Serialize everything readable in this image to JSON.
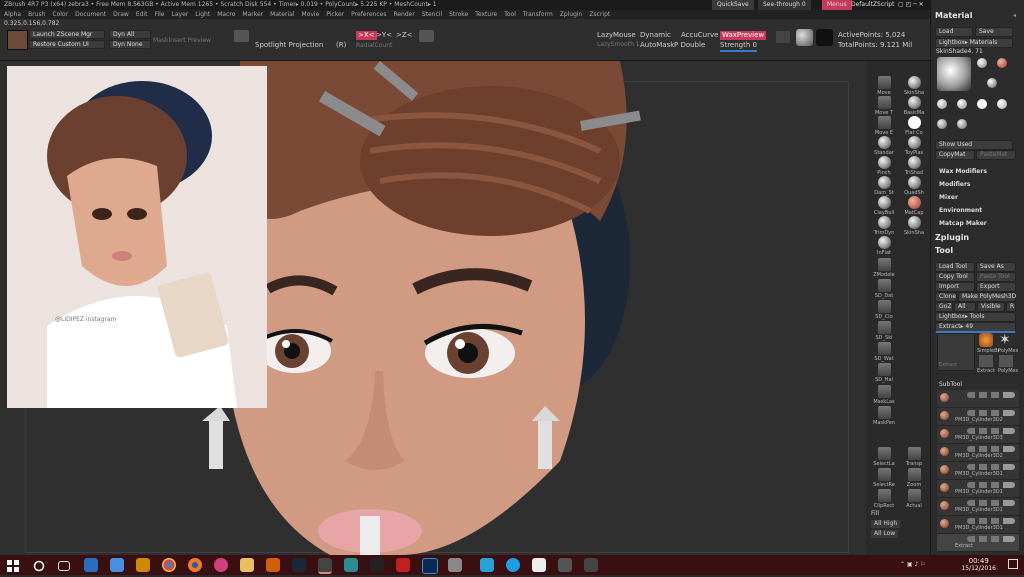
{
  "titlebar": {
    "title": "ZBrush 4R7 P3 (x64)   zebra3   • Free Mem 8.563GB • Active Mem 1265 • Scratch Disk 554 • Timer▸ 0.019 • PolyCount▸ 5.225 KP • MeshCount▸ 1",
    "quicksave": "QuickSave",
    "seethrough": "See-through  0",
    "menus": "Menus",
    "defaultzscript": "DefaultZScript"
  },
  "menubar": [
    "Alpha",
    "Brush",
    "Color",
    "Document",
    "Draw",
    "Edit",
    "File",
    "Layer",
    "Light",
    "Macro",
    "Marker",
    "Material",
    "Movie",
    "Picker",
    "Preferences",
    "Render",
    "Stencil",
    "Stroke",
    "Texture",
    "Tool",
    "Transform",
    "Zplugin",
    "Zscript"
  ],
  "shelf": {
    "coords": "0.325,0.156,0.782",
    "launch": "Launch ZScene Mgr",
    "restore": "Restore Custom UI",
    "dyn_all": "Dyn All",
    "dyn_none": "Dyn None",
    "mask_insert": "MaskInsert Preview",
    "spotlight": "Spotlight Projection",
    "r_label": "(R)",
    "sym_x": ">X<",
    "sym_y": ">Y<",
    "sym_z": ">Z<",
    "radial": "RadialCount",
    "lazymouse": "LazyMouse",
    "lazysmooth": "LazySmooth 1",
    "dynamic": "Dynamic",
    "accucurve": "AccuCurve",
    "automask": "AutoMask",
    "p_double": "P Double",
    "waxpreview": "WaxPreview",
    "strength": "Strength 0",
    "activepoints": "ActivePoints: 5,024",
    "totalpoints": "TotalPoints: 9.121 Mil"
  },
  "tools": [
    "Move",
    "SkinSha",
    "Move T",
    "BasicMa",
    "Move E",
    "Flat Co",
    "Standar",
    "ToyPlas",
    "Pinch",
    "TriShad",
    "Dam_St",
    "QuadSh",
    "ClayBuil",
    "MatCap",
    "TrimDyn",
    "SkinSha",
    "InFlat",
    "ZModele",
    "SD_Dat",
    "SD_Clo",
    "SD_Ski",
    "SD_Wat",
    "SD_Hai",
    "MaskLas",
    "MaskPen",
    "SelectLa",
    "SelectRe",
    "ClipRect",
    "Transp",
    "Zoom",
    "Actual"
  ],
  "toolcol_bottom": {
    "fill": "Fill",
    "all_high": "All High",
    "all_low": "All Low"
  },
  "material": {
    "header": "Material",
    "load": "Load",
    "save": "Save",
    "lightbox": "Lightbox▸ Materials",
    "current": "SkinShade4. 71",
    "thumbs": [
      "SkinShade4",
      "MatCap",
      "Chrome",
      "BasicMa",
      "BasicMa",
      "Col",
      "ToyPlas",
      "TriShad",
      "QuadSh"
    ],
    "show_used": "Show Used",
    "copymat": "CopyMat",
    "pastemat": "PasteMat",
    "sections": [
      "Wax Modifiers",
      "Modifiers",
      "Mixer",
      "Environment",
      "Matcap Maker"
    ]
  },
  "zplugin": {
    "header": "Zplugin"
  },
  "tool": {
    "header": "Tool",
    "load_tool": "Load Tool",
    "save_as": "Save As",
    "copy_tool": "Copy Tool",
    "paste_tool": "Paste Tool",
    "import": "Import",
    "export": "Export",
    "clone": "Clone",
    "make_polymesh": "Make PolyMesh3D",
    "goz": "GoZ",
    "all": "All",
    "visible": "Visible",
    "r": "R",
    "lightbox_tools": "Lightbox▸ Tools",
    "extract": "Extract▸ 49",
    "simple": "SimpleBr",
    "polymesh": "PolyMes",
    "extract2": "Extract",
    "extract3": "Extract",
    "polymes2": "PolyMes"
  },
  "subtool": {
    "header": "SubTool",
    "rows": [
      "PM3D_Cylinder3D2",
      "PM3D_Cylinder3D3",
      "PM3D_Cylinder3D2",
      "PM3D_Cylinder3D1",
      "PM3D_Cylinder3D1",
      "PM3D_Cylinder3D1",
      "PM3D_Cylinder3D1",
      "PM3D_Cylinder3D1",
      "Extract"
    ]
  },
  "reference": {
    "signature": "@LIDIPEZ  instagram"
  },
  "taskbar": {
    "icons": [
      "windows-icon",
      "search-icon",
      "taskview-icon",
      "store-icon",
      "dropbox-icon",
      "chrome-icon",
      "firefox-icon",
      "itunes-icon",
      "folder-icon",
      "steam-icon",
      "zbrush-icon",
      "sculptris-icon",
      "maya-icon",
      "opera-icon",
      "photoshop-icon",
      "paint-icon",
      "skype-icon",
      "mail-icon",
      "photos-icon",
      "vlc-icon"
    ],
    "time": "00:49",
    "date": "15/12/2016"
  },
  "colors": {
    "taskbar": "#3a0f12",
    "accent": "#c8385a",
    "panel": "#2c2c2c",
    "canvas": "#2f2f2f"
  }
}
